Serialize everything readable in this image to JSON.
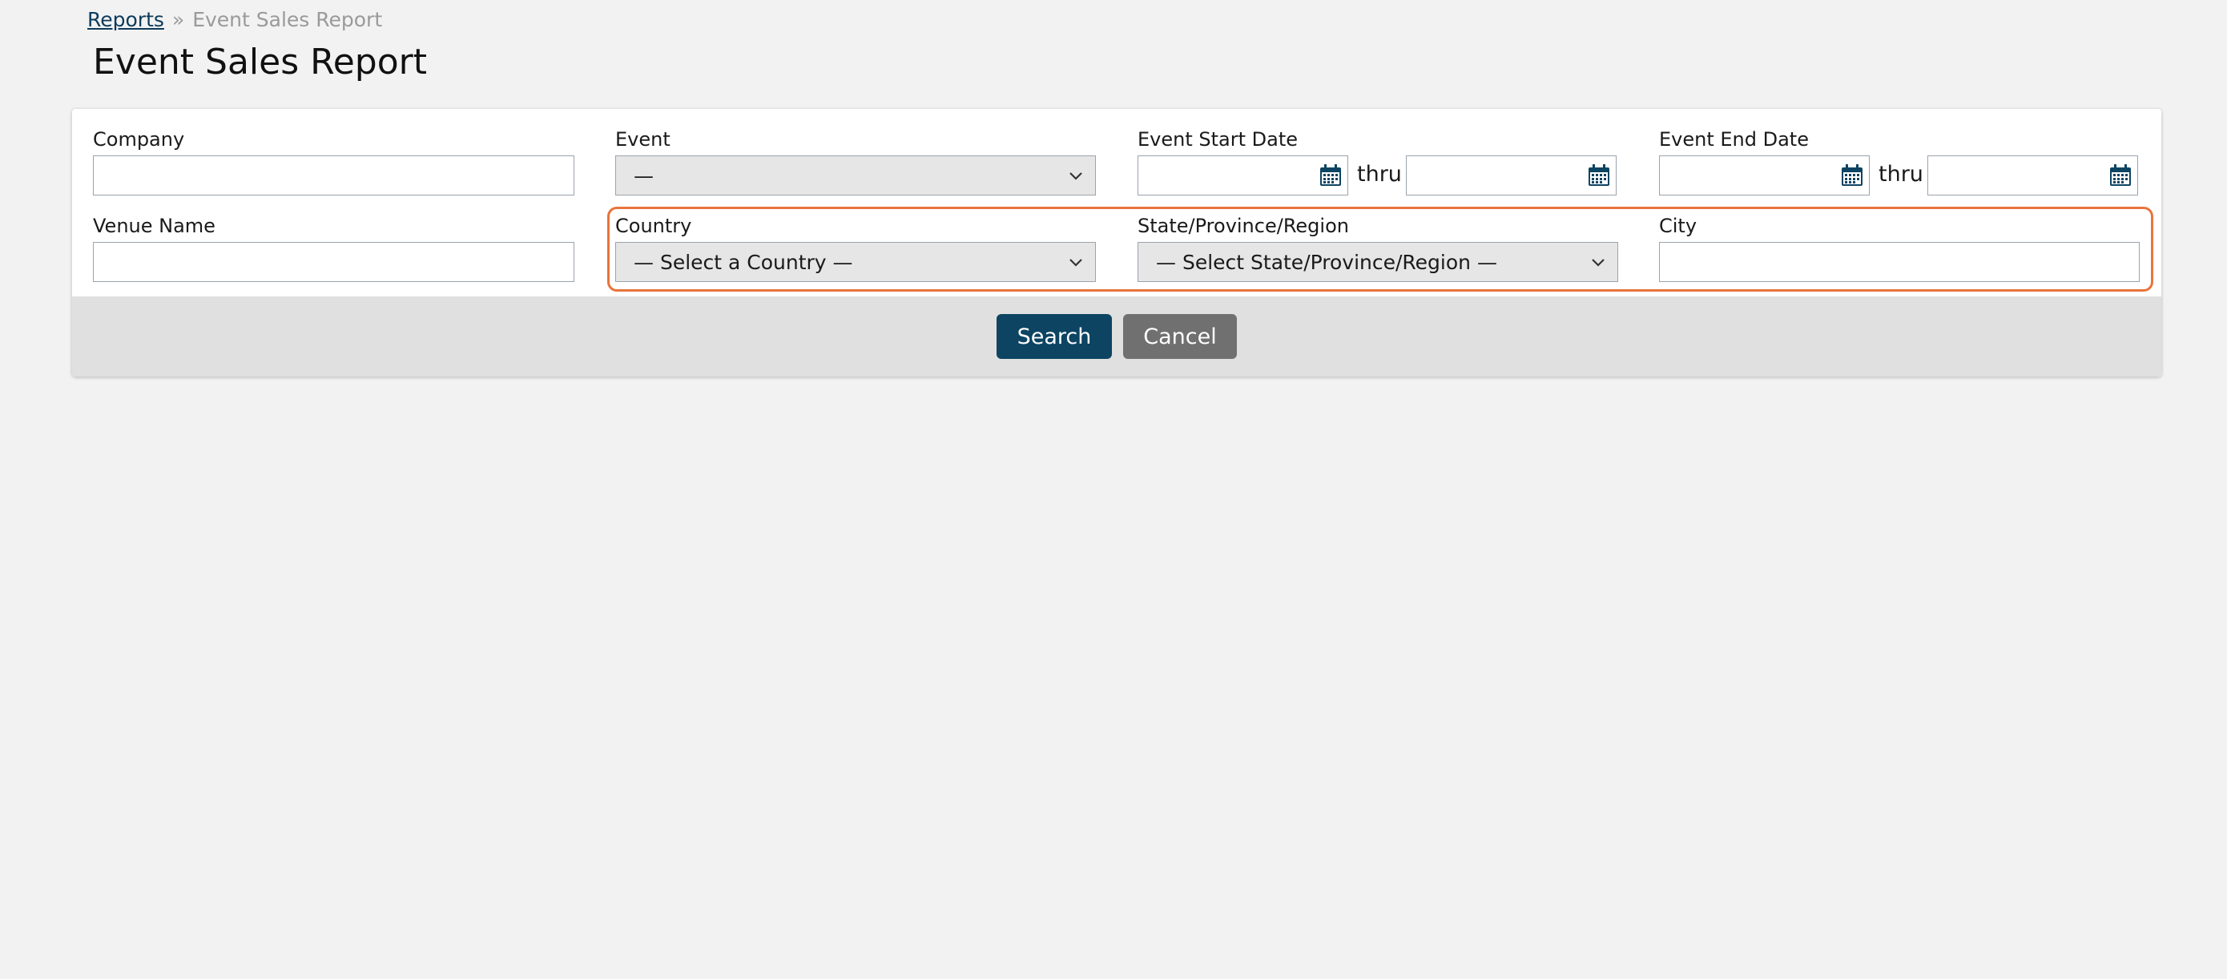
{
  "breadcrumb": {
    "parent": "Reports",
    "separator": "»",
    "current": "Event Sales Report"
  },
  "page": {
    "title": "Event Sales Report"
  },
  "form": {
    "company": {
      "label": "Company",
      "value": ""
    },
    "event": {
      "label": "Event",
      "selected": "—"
    },
    "event_start_date": {
      "label": "Event Start Date",
      "from": "",
      "to": "",
      "thru_label": "thru"
    },
    "event_end_date": {
      "label": "Event End Date",
      "from": "",
      "to": "",
      "thru_label": "thru"
    },
    "venue_name": {
      "label": "Venue Name",
      "value": ""
    },
    "country": {
      "label": "Country",
      "selected": "— Select a Country —"
    },
    "state": {
      "label": "State/Province/Region",
      "selected": "— Select State/Province/Region —"
    },
    "city": {
      "label": "City",
      "value": ""
    }
  },
  "actions": {
    "search_label": "Search",
    "cancel_label": "Cancel"
  },
  "colors": {
    "highlight": "#e8743b",
    "primary_button": "#0c4462",
    "secondary_button": "#707070",
    "link": "#0d3b5c"
  },
  "icons": {
    "calendar": "calendar-icon",
    "dropdown": "chevron-down-icon"
  }
}
